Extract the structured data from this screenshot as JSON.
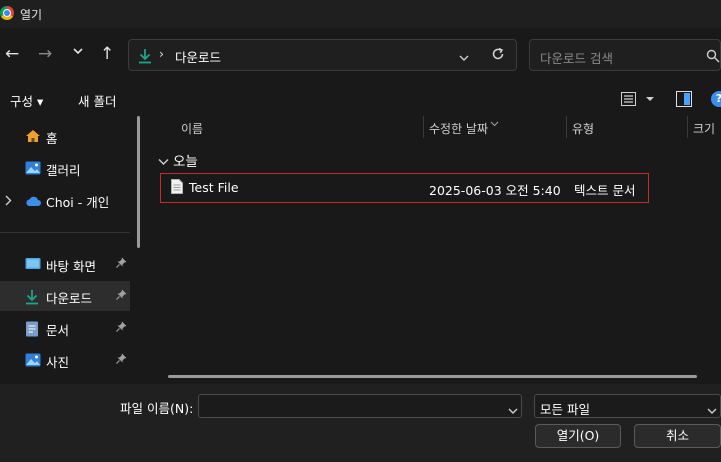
{
  "window": {
    "title": "열기"
  },
  "nav": {
    "back": "←",
    "forward": "→",
    "recent": "⌄",
    "up": "↑"
  },
  "address": {
    "separator": "›",
    "current": "다운로드"
  },
  "search": {
    "placeholder": "다운로드 검색"
  },
  "toolbar": {
    "organize": "구성 ▾",
    "new_folder": "새 폴더"
  },
  "sidebar": {
    "items": [
      {
        "label": "홈"
      },
      {
        "label": "갤러리"
      },
      {
        "label": "Choi - 개인"
      },
      {
        "label": "바탕 화면"
      },
      {
        "label": "다운로드"
      },
      {
        "label": "문서"
      },
      {
        "label": "사진"
      }
    ]
  },
  "columns": {
    "name": "이름",
    "modified": "수정한 날짜",
    "type": "유형",
    "size": "크기"
  },
  "group": {
    "label": "오늘"
  },
  "files": [
    {
      "name": "Test File",
      "modified": "2025-06-03 오전 5:40",
      "type": "텍스트 문서"
    }
  ],
  "footer": {
    "filename_label": "파일 이름(N):",
    "filename_value": "",
    "filter_value": "모든 파일",
    "open_label": "열기(O)",
    "cancel_label": "취소"
  },
  "colors": {
    "background": "#191919",
    "selection_border": "#c42b2b",
    "accent": "#1fa38a"
  }
}
